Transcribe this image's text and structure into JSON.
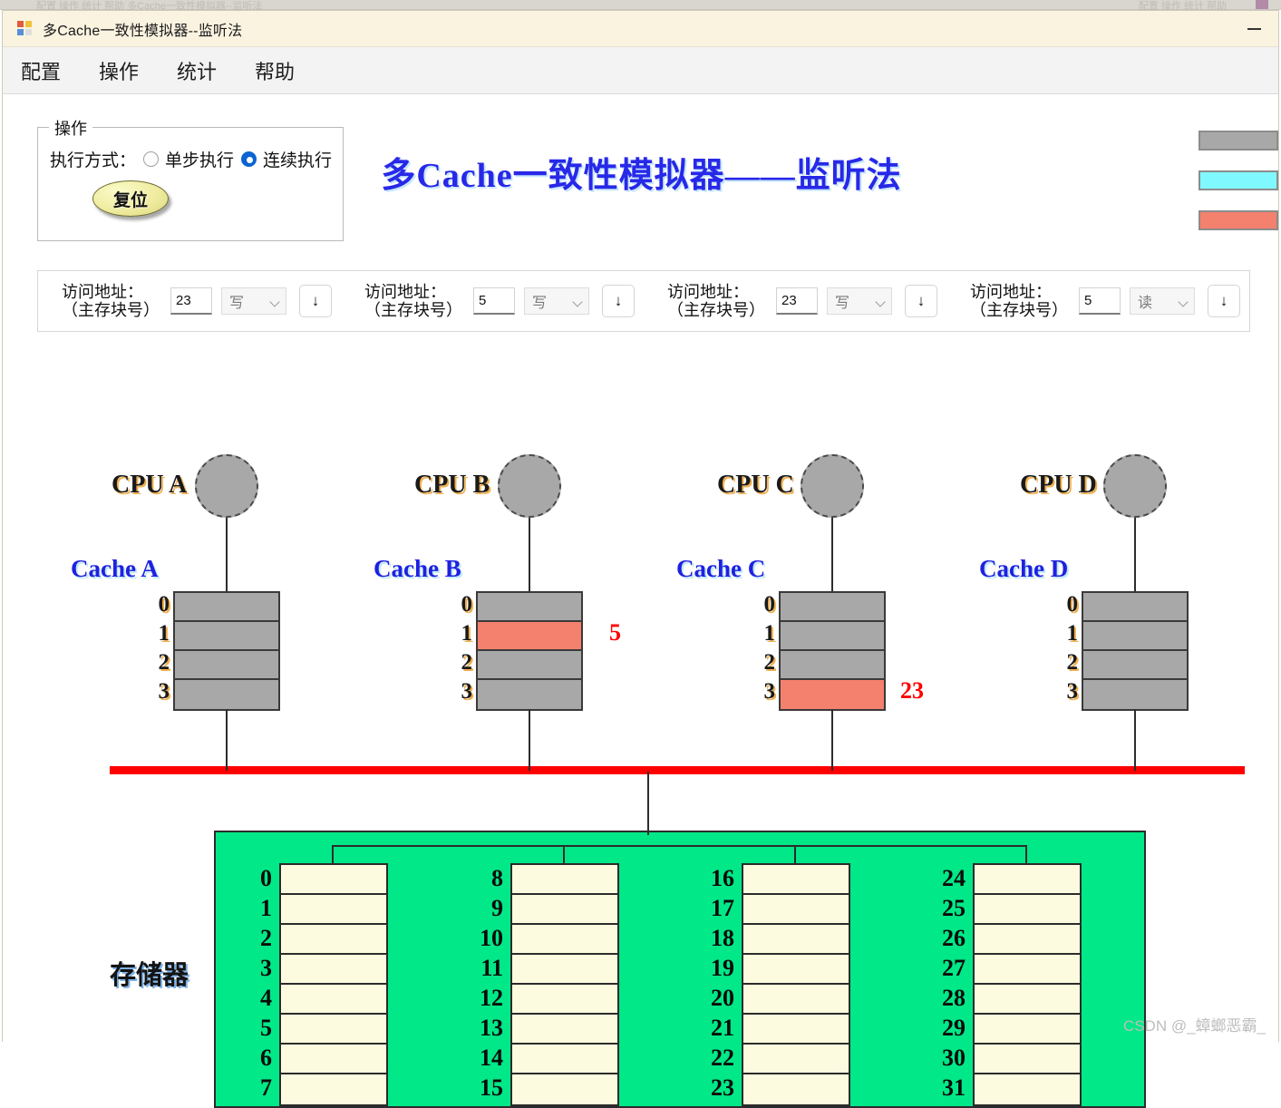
{
  "background_window": {
    "ghost_text": "配置  操作  统计  帮助      多Cache一致性模拟器--监听法",
    "ghost_right": "配置  操作  统计  帮助"
  },
  "window": {
    "title": "多Cache一致性模拟器--监听法",
    "minimize_label": "—",
    "app_icon": "app-window-icon"
  },
  "menubar": {
    "items": [
      {
        "label": "配置",
        "name": "menu-config"
      },
      {
        "label": "操作",
        "name": "menu-operation"
      },
      {
        "label": "统计",
        "name": "menu-statistics"
      },
      {
        "label": "帮助",
        "name": "menu-help"
      }
    ]
  },
  "operation_group": {
    "legend": "操作",
    "exec_mode_label": "执行方式：",
    "radios": [
      {
        "label": "单步执行",
        "checked": false
      },
      {
        "label": "连续执行",
        "checked": true
      }
    ],
    "reset_button": "复位"
  },
  "main_title": "多Cache一致性模拟器——监听法",
  "legend_swatches": [
    {
      "name": "legend-swatch-gray",
      "color": "#a8a8a8"
    },
    {
      "name": "legend-swatch-cyan",
      "color": "#80f8ff"
    },
    {
      "name": "legend-swatch-salmon",
      "color": "#f4806e"
    }
  ],
  "address_panel": {
    "groups": [
      {
        "label_line1": "访问地址：",
        "label_line2": "（主存块号）",
        "value": "23",
        "op": "写",
        "button": "↓"
      },
      {
        "label_line1": "访问地址：",
        "label_line2": "（主存块号）",
        "value": "5",
        "op": "写",
        "button": "↓"
      },
      {
        "label_line1": "访问地址：",
        "label_line2": "（主存块号）",
        "value": "23",
        "op": "写",
        "button": "↓"
      },
      {
        "label_line1": "访问地址：",
        "label_line2": "（主存块号）",
        "value": "5",
        "op": "读",
        "button": "↓"
      }
    ]
  },
  "processors": [
    {
      "cpu_label": "CPU A",
      "cache_label": "Cache A",
      "lines": [
        {
          "index": "0",
          "state": "gray",
          "value": ""
        },
        {
          "index": "1",
          "state": "gray",
          "value": ""
        },
        {
          "index": "2",
          "state": "gray",
          "value": ""
        },
        {
          "index": "3",
          "state": "gray",
          "value": ""
        }
      ]
    },
    {
      "cpu_label": "CPU B",
      "cache_label": "Cache B",
      "lines": [
        {
          "index": "0",
          "state": "gray",
          "value": ""
        },
        {
          "index": "1",
          "state": "hot",
          "value": "5"
        },
        {
          "index": "2",
          "state": "gray",
          "value": ""
        },
        {
          "index": "3",
          "state": "gray",
          "value": ""
        }
      ]
    },
    {
      "cpu_label": "CPU C",
      "cache_label": "Cache C",
      "lines": [
        {
          "index": "0",
          "state": "gray",
          "value": ""
        },
        {
          "index": "1",
          "state": "gray",
          "value": ""
        },
        {
          "index": "2",
          "state": "gray",
          "value": ""
        },
        {
          "index": "3",
          "state": "hot",
          "value": "23"
        }
      ]
    },
    {
      "cpu_label": "CPU D",
      "cache_label": "Cache D",
      "lines": [
        {
          "index": "0",
          "state": "gray",
          "value": ""
        },
        {
          "index": "1",
          "state": "gray",
          "value": ""
        },
        {
          "index": "2",
          "state": "gray",
          "value": ""
        },
        {
          "index": "3",
          "state": "gray",
          "value": ""
        }
      ]
    }
  ],
  "memory": {
    "label": "存储器",
    "columns": [
      {
        "indices": [
          "0",
          "1",
          "2",
          "3",
          "4",
          "5",
          "6",
          "7"
        ]
      },
      {
        "indices": [
          "8",
          "9",
          "10",
          "11",
          "12",
          "13",
          "14",
          "15"
        ]
      },
      {
        "indices": [
          "16",
          "17",
          "18",
          "19",
          "20",
          "21",
          "22",
          "23"
        ]
      },
      {
        "indices": [
          "24",
          "25",
          "26",
          "27",
          "28",
          "29",
          "30",
          "31"
        ]
      }
    ]
  },
  "colors": {
    "bus": "#ff0000",
    "memory_bg": "#00e887",
    "memory_cell": "#fdfbdf",
    "cache_gray": "#a8a8a8",
    "cache_hot": "#f4806e",
    "title_blue": "#2828e8"
  },
  "watermark": "CSDN @_蟑螂恶霸_"
}
